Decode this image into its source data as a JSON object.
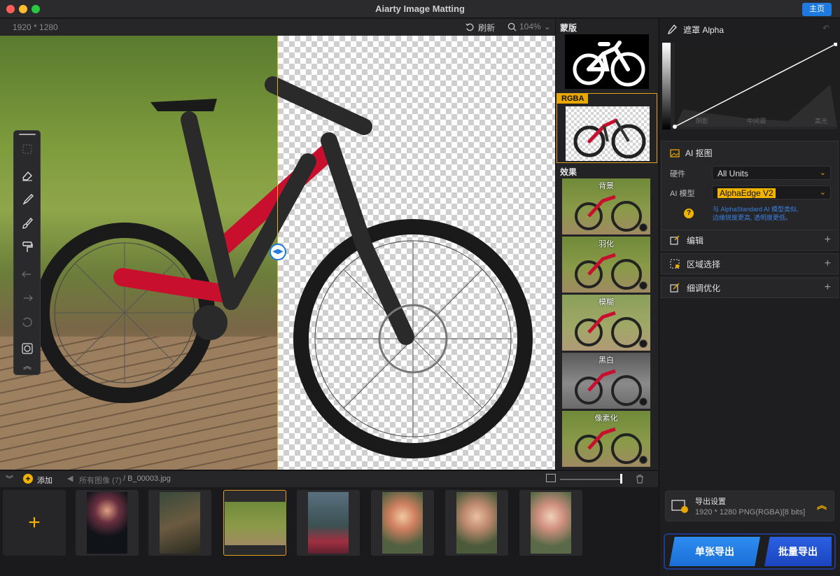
{
  "window": {
    "title": "Aiarty Image Matting",
    "home_button": "主页"
  },
  "canvas": {
    "image_size": "1920 * 1280",
    "refresh_label": "刷新",
    "zoom": "104%"
  },
  "middle": {
    "mask_label": "蒙版",
    "rgba_label": "RGBA",
    "effects_label": "效果",
    "effects": [
      "背景",
      "羽化",
      "模糊",
      "黑白",
      "像素化"
    ]
  },
  "right": {
    "alpha_title": "遮罩 Alpha",
    "curve_labels": [
      "阴影",
      "中间调",
      "高光"
    ],
    "ai_section": {
      "title": "AI 抠图",
      "hardware_label": "硬件",
      "hardware_value": "All Units",
      "model_label": "AI 模型",
      "model_value": "AlphaEdge  V2",
      "hint_line1": "与 AlphaStandard AI 模型类似,",
      "hint_line2": "边缘锐度更高, 透明度更低。"
    },
    "edit_label": "编辑",
    "region_label": "区域选择",
    "refine_label": "细调优化",
    "export_settings": {
      "title": "导出设置",
      "detail": "1920 * 1280 PNG(RGBA)[8 bits]"
    },
    "export_single": "单张导出",
    "export_batch": "批量导出"
  },
  "strip": {
    "add_label": "添加",
    "all_images": "所有图像 (7)",
    "current_file": "/ B_00003.jpg"
  }
}
